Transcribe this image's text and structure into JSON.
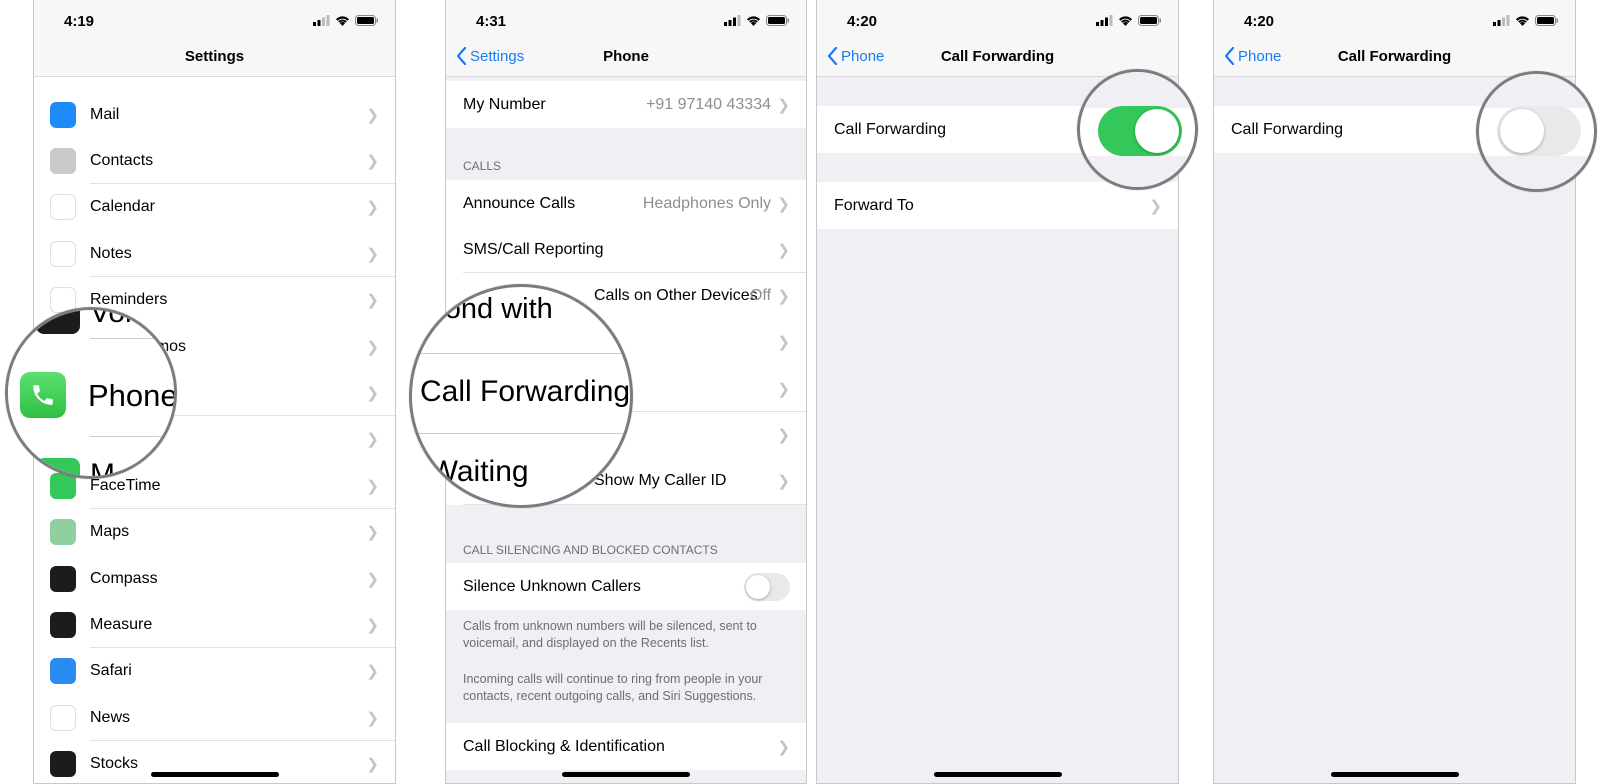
{
  "screens": [
    {
      "status_time": "4:19",
      "nav_title": "Settings",
      "items": [
        {
          "label": "Mail",
          "icon": "mail-icon",
          "color": "#1e8cf8"
        },
        {
          "label": "Contacts",
          "icon": "contacts-icon",
          "color": "#c9c9c9"
        },
        {
          "label": "Calendar",
          "icon": "calendar-icon",
          "color": "#ffffff"
        },
        {
          "label": "Notes",
          "icon": "notes-icon",
          "color": "#ffffff"
        },
        {
          "label": "Reminders",
          "icon": "reminders-icon",
          "color": "#ffffff"
        },
        {
          "label": "Voice Memos",
          "icon": "voice-memos-icon",
          "color": "#1c1c1e"
        },
        {
          "label": "Phone",
          "icon": "phone-icon",
          "color": "#34c759"
        },
        {
          "label": "Messages",
          "icon": "messages-icon",
          "color": "#34c759"
        },
        {
          "label": "FaceTime",
          "icon": "facetime-icon",
          "color": "#34c759"
        },
        {
          "label": "Maps",
          "icon": "maps-icon",
          "color": "#8fd0a0"
        },
        {
          "label": "Compass",
          "icon": "compass-icon",
          "color": "#1c1c1e"
        },
        {
          "label": "Measure",
          "icon": "measure-icon",
          "color": "#1c1c1e"
        },
        {
          "label": "Safari",
          "icon": "safari-icon",
          "color": "#2a8cf0"
        },
        {
          "label": "News",
          "icon": "news-icon",
          "color": "#ffffff"
        },
        {
          "label": "Stocks",
          "icon": "stocks-icon",
          "color": "#1c1c1e"
        }
      ],
      "magnifier": {
        "label_top": "Voi",
        "label_main": "Phone",
        "label_bottom": "M"
      }
    },
    {
      "status_time": "4:31",
      "back_label": "Settings",
      "nav_title": "Phone",
      "my_number": {
        "label": "My Number",
        "value": "+91 97140 43334"
      },
      "calls_header": "CALLS",
      "calls": [
        {
          "label": "Announce Calls",
          "value": "Headphones Only"
        },
        {
          "label": "SMS/Call Reporting",
          "value": ""
        },
        {
          "label": "Respond with Text on Other Devices",
          "visible_label": "Calls on Other Devices",
          "value": "Off"
        },
        {
          "label": "Respond with Text",
          "value": ""
        },
        {
          "label": "Call Forwarding",
          "value": ""
        },
        {
          "label": "Call Waiting",
          "value": ""
        },
        {
          "label": "Show My Caller ID",
          "visible_label": "Show My Caller ID",
          "value": ""
        }
      ],
      "silencing_header": "CALL SILENCING AND BLOCKED CONTACTS",
      "silence_unknown": {
        "label": "Silence Unknown Callers",
        "on": false
      },
      "footnote_1": "Calls from unknown numbers will be silenced, sent to voicemail, and displayed on the Recents list.",
      "footnote_2": "Incoming calls will continue to ring from people in your contacts, recent outgoing calls, and Siri Suggestions.",
      "call_blocking": "Call Blocking & Identification",
      "magnifier": {
        "top": "espond with",
        "main": "Call Forwarding",
        "bottom": "ll Waiting"
      }
    },
    {
      "status_time": "4:20",
      "back_label": "Phone",
      "nav_title": "Call Forwarding",
      "toggle_label": "Call Forwarding",
      "toggle_on": true,
      "forward_to": "Forward To"
    },
    {
      "status_time": "4:20",
      "back_label": "Phone",
      "nav_title": "Call Forwarding",
      "toggle_label": "Call Forwarding",
      "toggle_on": false
    }
  ]
}
